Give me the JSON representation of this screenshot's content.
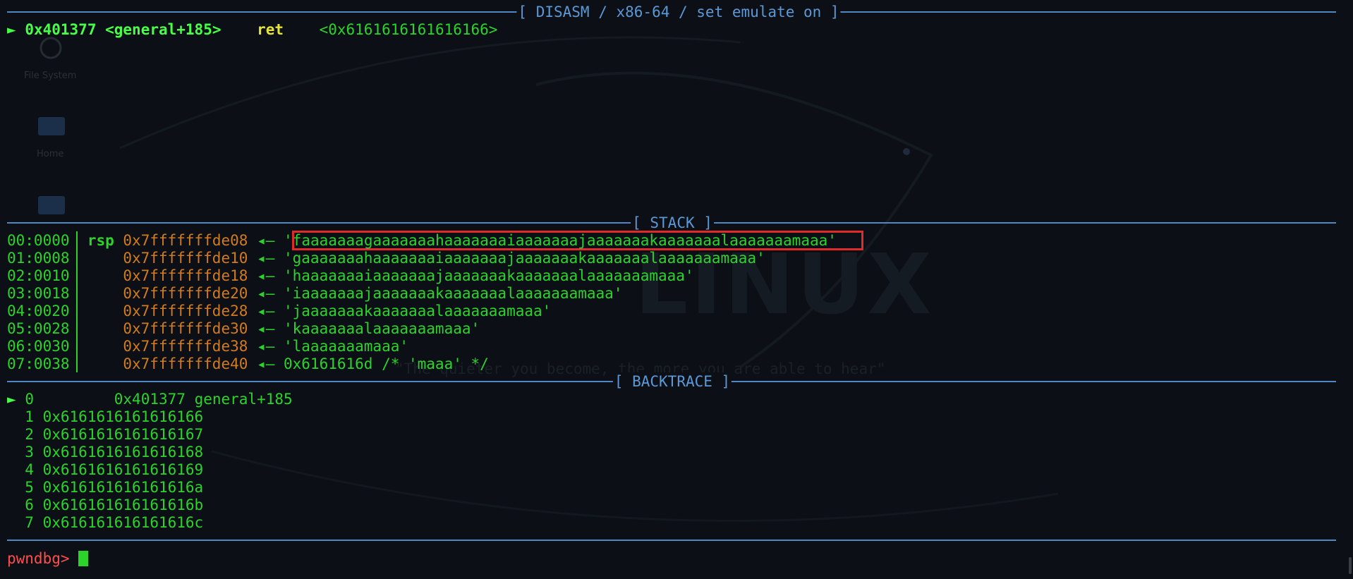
{
  "theme": {
    "background": "#0c1016",
    "green": "#2bd32b",
    "header_blue": "#5b98d6",
    "address_orange": "#d27b1e",
    "mnemonic_yellow": "#e3e33a",
    "prompt_red": "#ff4d4d",
    "highlight_red": "#e02b2b"
  },
  "desktop": {
    "icons": [
      "File System",
      "Home"
    ],
    "watermark": "LINUX",
    "tagline": "\"The quieter you become, the more you are able to hear\""
  },
  "disasm": {
    "header": "[ DISASM / x86-64 / set emulate on ]",
    "marker": "►",
    "address": "0x401377",
    "symbol": "<general+185>",
    "mnemonic": "ret",
    "operand": "<0x6161616161616166>"
  },
  "stack": {
    "header": "[ STACK ]",
    "arrow": "◂—",
    "rows": [
      {
        "offset": "00:0000",
        "reg": "rsp",
        "addr": "0x7fffffffde08",
        "value": "'faaaaaaagaaaaaaahaaaaaaaiaaaaaaajaaaaaaakaaaaaaalaaaaaaamaaa'"
      },
      {
        "offset": "01:0008",
        "reg": "",
        "addr": "0x7fffffffde10",
        "value": "'gaaaaaaahaaaaaaaiaaaaaaajaaaaaaakaaaaaaalaaaaaaamaaa'"
      },
      {
        "offset": "02:0010",
        "reg": "",
        "addr": "0x7fffffffde18",
        "value": "'haaaaaaaiaaaaaaajaaaaaaakaaaaaaalaaaaaaamaaa'"
      },
      {
        "offset": "03:0018",
        "reg": "",
        "addr": "0x7fffffffde20",
        "value": "'iaaaaaaajaaaaaaakaaaaaaalaaaaaaamaaa'"
      },
      {
        "offset": "04:0020",
        "reg": "",
        "addr": "0x7fffffffde28",
        "value": "'jaaaaaaakaaaaaaalaaaaaaamaaa'"
      },
      {
        "offset": "05:0028",
        "reg": "",
        "addr": "0x7fffffffde30",
        "value": "'kaaaaaaalaaaaaaamaaa'"
      },
      {
        "offset": "06:0030",
        "reg": "",
        "addr": "0x7fffffffde38",
        "value": "'laaaaaaamaaa'"
      },
      {
        "offset": "07:0038",
        "reg": "",
        "addr": "0x7fffffffde40",
        "value": "0x6161616d /* 'maaa' */"
      }
    ]
  },
  "backtrace": {
    "header": "[ BACKTRACE ]",
    "marker": "►",
    "first": {
      "index": "0",
      "address": "0x401377",
      "symbol": "general+185"
    },
    "frames": [
      {
        "index": "1",
        "address": "0x6161616161616166"
      },
      {
        "index": "2",
        "address": "0x6161616161616167"
      },
      {
        "index": "3",
        "address": "0x6161616161616168"
      },
      {
        "index": "4",
        "address": "0x6161616161616169"
      },
      {
        "index": "5",
        "address": "0x616161616161616a"
      },
      {
        "index": "6",
        "address": "0x616161616161616b"
      },
      {
        "index": "7",
        "address": "0x616161616161616c"
      }
    ]
  },
  "prompt": {
    "label": "pwndbg>",
    "input": ""
  }
}
